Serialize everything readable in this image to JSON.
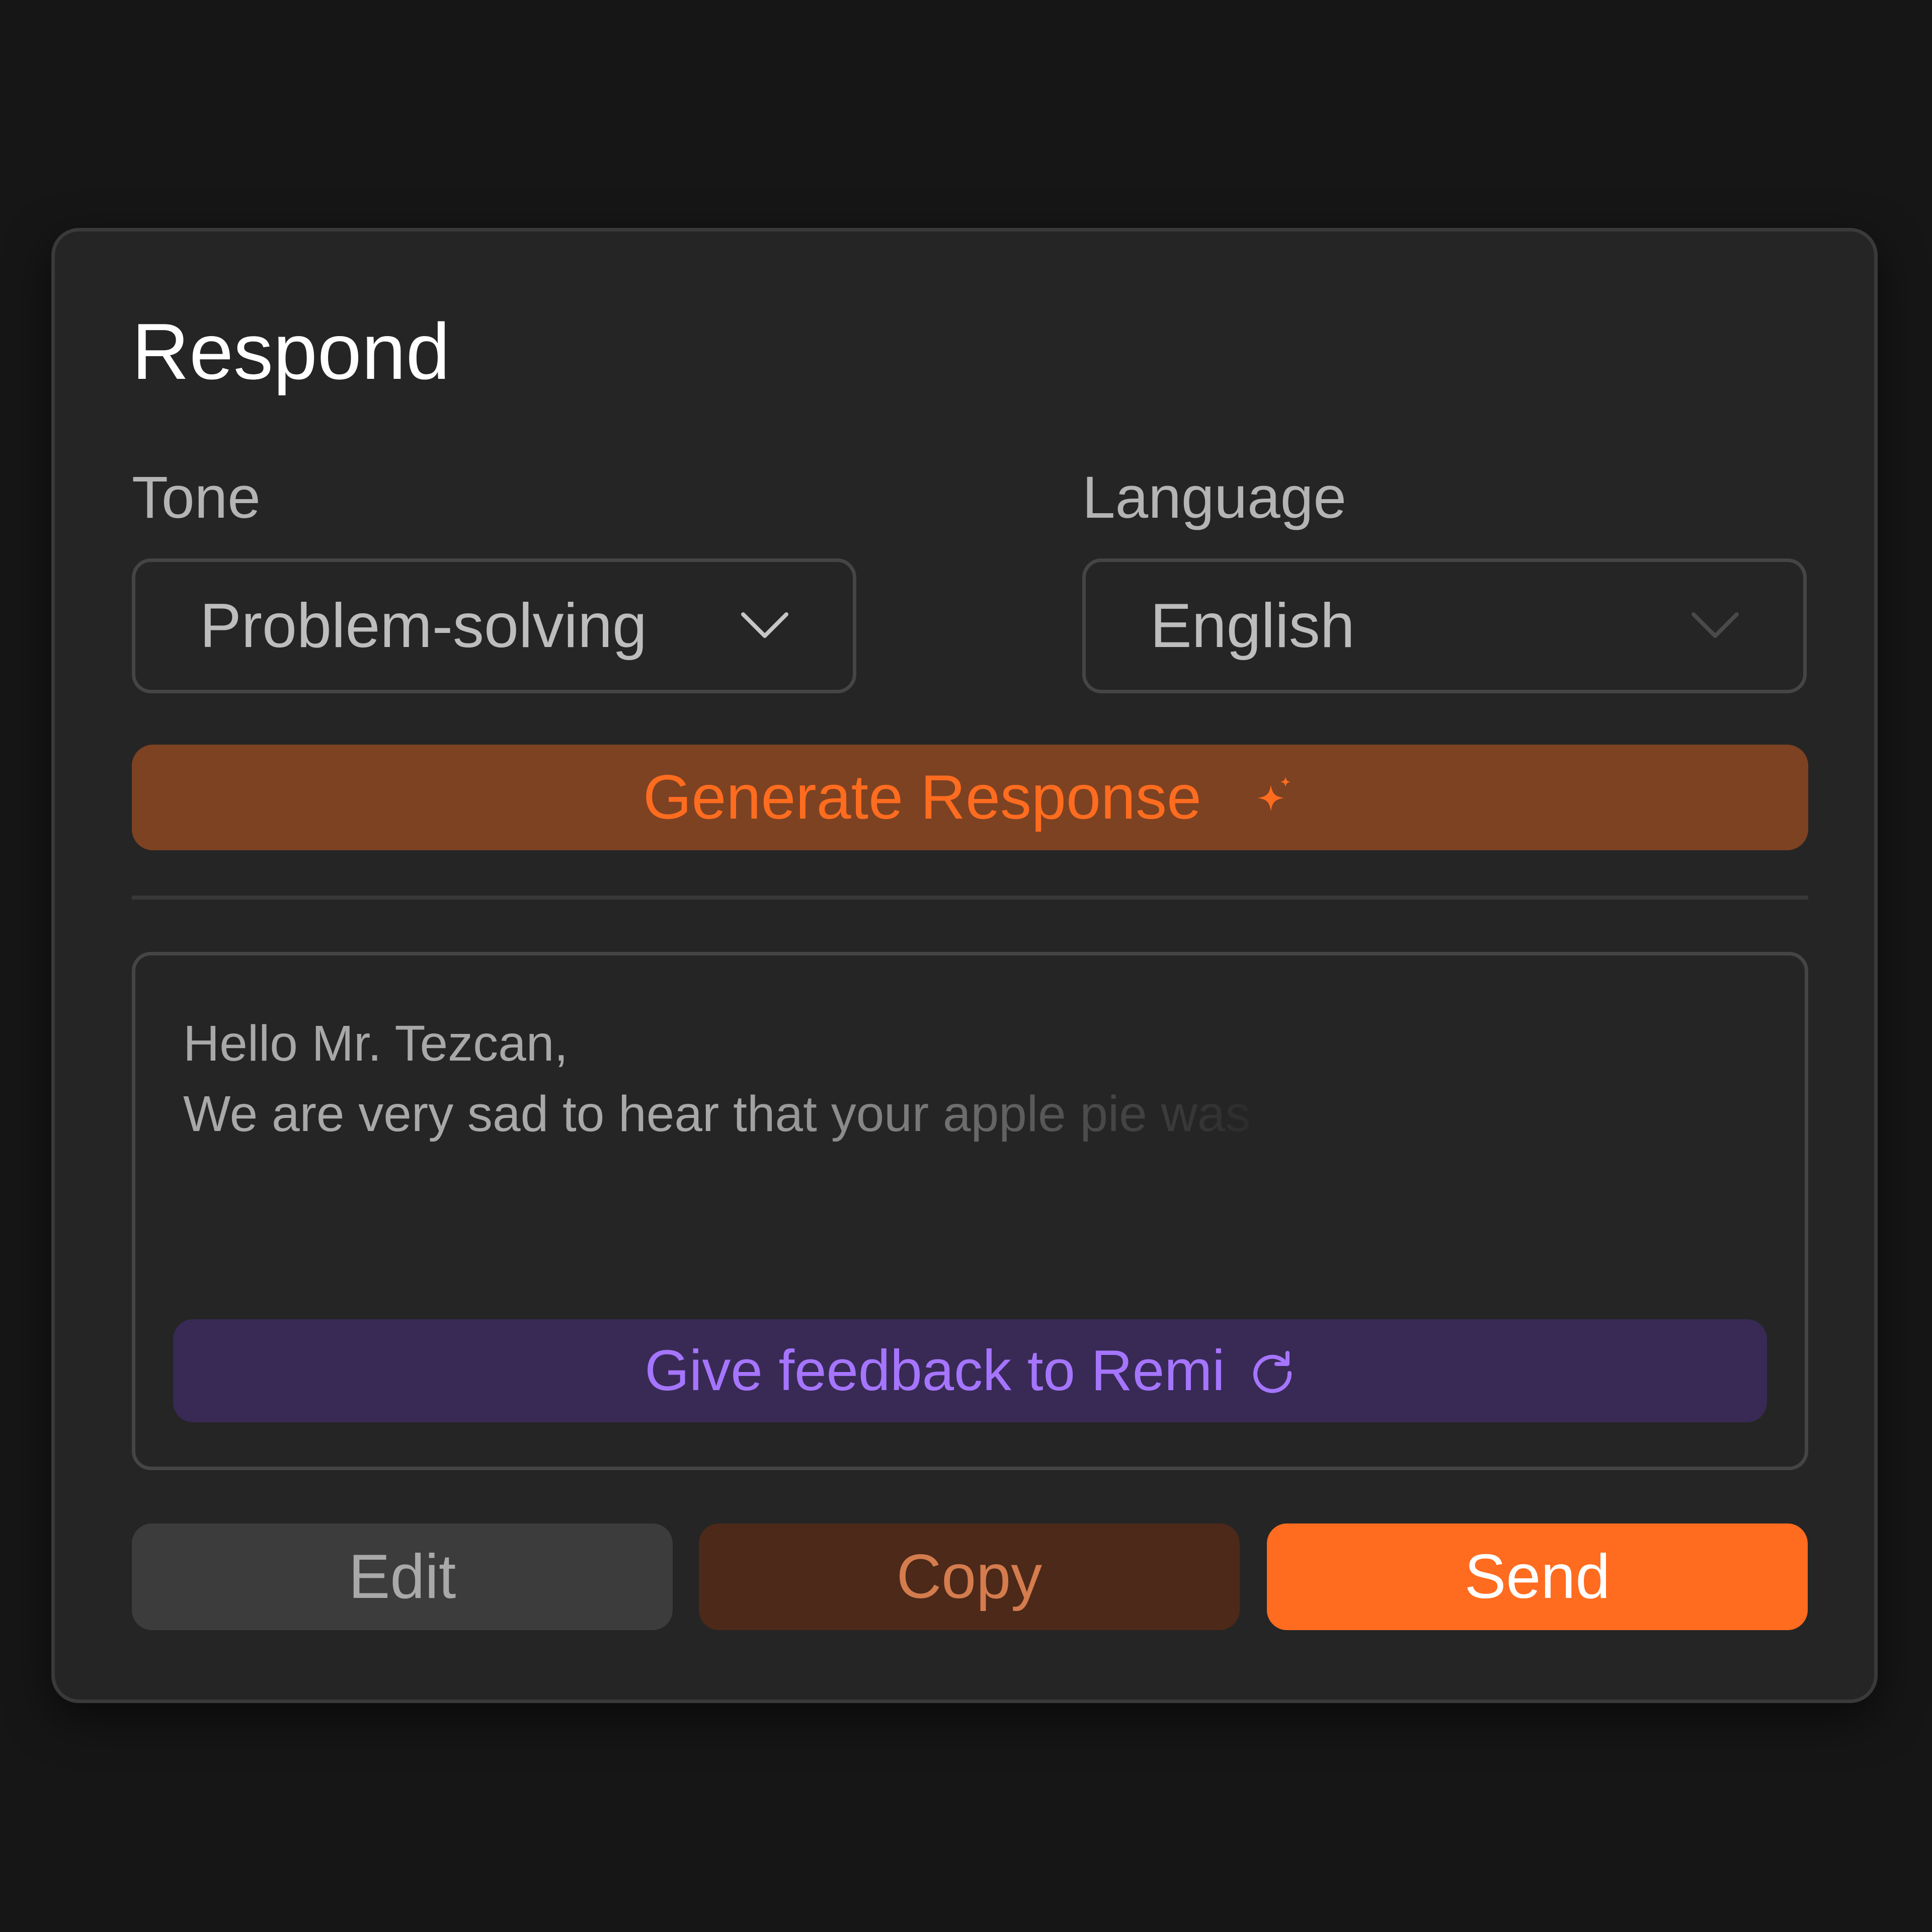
{
  "panel": {
    "title": "Respond"
  },
  "tone": {
    "label": "Tone",
    "value": "Problem-solving"
  },
  "language": {
    "label": "Language",
    "value": "English"
  },
  "generate": {
    "label": "Generate Response",
    "icon": "sparkle-icon"
  },
  "response": {
    "lines": [
      "Hello Mr. Tezcan,",
      "We are very sad to hear that your apple pie was"
    ]
  },
  "feedback": {
    "label": "Give feedback to Remi",
    "icon": "refresh-icon"
  },
  "actions": {
    "edit_label": "Edit",
    "copy_label": "Copy",
    "send_label": "Send"
  },
  "colors": {
    "background": "#161616",
    "panel": "#252525",
    "accent_orange": "#ff6c1f",
    "generate_bg": "#7d4222",
    "copy_bg": "#4c2918",
    "feedback_bg": "#382a55",
    "feedback_text": "#a675ff"
  }
}
